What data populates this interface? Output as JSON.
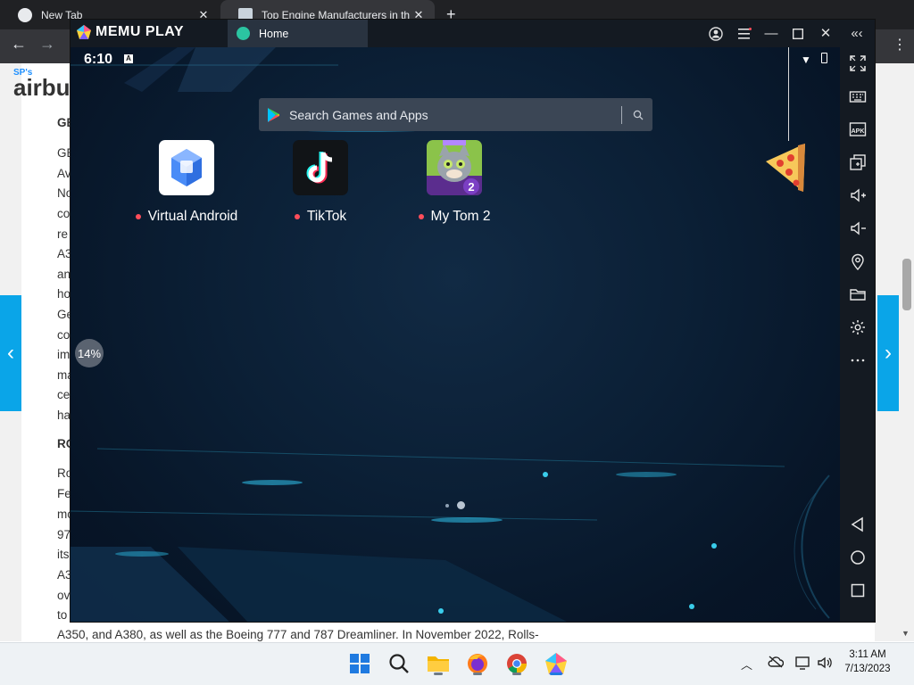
{
  "browser": {
    "tabs": [
      {
        "label": "New Tab"
      },
      {
        "label": "Top Engine Manufacturers in the"
      }
    ],
    "new_tab_symbol": "+",
    "back_symbol": "←",
    "forward_symbol": "→",
    "menu_symbol": "⋮"
  },
  "site": {
    "logo_sub": "SP's",
    "logo": "airbu",
    "edge_lines": [
      "GE",
      "GE",
      "Av",
      "No",
      "co",
      "re",
      "A3",
      "an",
      "ho",
      "Ge",
      "co",
      "im",
      "ma",
      "ce",
      "ha",
      "RO",
      "Ro",
      "Fe",
      "mo",
      "97",
      "its",
      "A3",
      "ov",
      "to"
    ],
    "bottom_text": "A350, and A380, as well as the Boeing 777 and 787 Dreamliner. In November 2022, Rolls-",
    "prev_symbol": "‹",
    "next_symbol": "›"
  },
  "memu": {
    "brand": "MEMU PLAY",
    "tab_label": "Home",
    "status_time": "6:10",
    "status_indicator": "A",
    "search_placeholder": "Search Games and Apps",
    "apps": [
      {
        "label": "Virtual Android",
        "icon": "virtual-android-icon"
      },
      {
        "label": "TikTok",
        "icon": "tiktok-icon"
      },
      {
        "label": "My Tom 2",
        "icon": "my-tom-2-icon"
      }
    ],
    "progress_label": "14%",
    "page_indicator": {
      "pages": 2,
      "current": 2
    }
  },
  "taskbar": {
    "time": "3:11 AM",
    "date": "7/13/2023"
  },
  "colors": {
    "accent_teal": "#2bc4a1",
    "side_blue": "#0aa5e8",
    "notification_red": "#ff4d5a"
  }
}
